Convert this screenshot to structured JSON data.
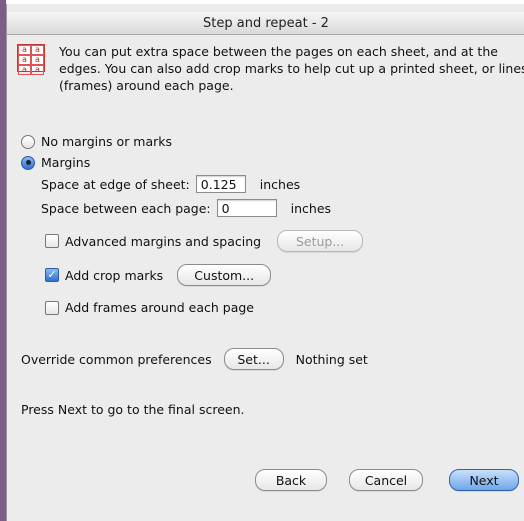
{
  "window": {
    "title": "Step and repeat - 2"
  },
  "intro": {
    "icon_glyph": "a",
    "text": "You can put extra space between the pages on each sheet, and at the edges. You can also add crop marks to help cut up a printed sheet, or lines (frames) around each page."
  },
  "options": {
    "no_margins_label": "No margins or marks",
    "margins_label": "Margins",
    "selected": "Margins"
  },
  "margins": {
    "edge_label": "Space at edge of sheet:",
    "edge_value": "0.125",
    "edge_unit": "inches",
    "between_label": "Space between each page:",
    "between_value": "0",
    "between_unit": "inches",
    "advanced_label": "Advanced margins and spacing",
    "advanced_checked": false,
    "setup_label": "Setup...",
    "crop_label": "Add crop marks",
    "crop_checked": true,
    "custom_label": "Custom...",
    "frames_label": "Add frames around each page",
    "frames_checked": false
  },
  "override": {
    "label": "Override common preferences",
    "button_label": "Set...",
    "status": "Nothing set"
  },
  "instructions": "Press Next to go to the final screen.",
  "footer": {
    "back_label": "Back",
    "cancel_label": "Cancel",
    "next_label": "Next"
  }
}
